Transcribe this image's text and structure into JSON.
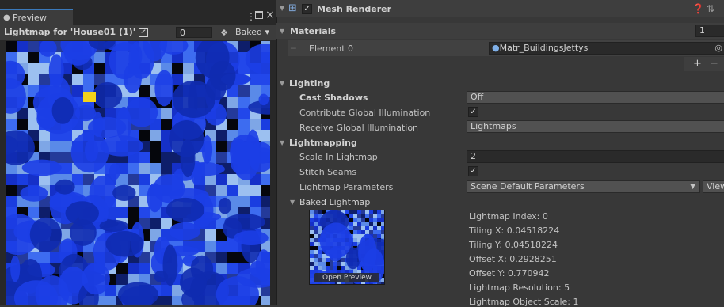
{
  "preview": {
    "tab_label": "Preview",
    "lightmap_title": "Lightmap for 'House01 (1)'",
    "lightmap_index": "0",
    "baked_label": "Baked"
  },
  "inspector": {
    "component_title": "Mesh Renderer",
    "materials": {
      "section": "Materials",
      "count": "1",
      "element_label": "Element 0",
      "element_value": "Matr_BuildingsJettys",
      "add": "+",
      "remove": "−"
    },
    "lighting": {
      "section": "Lighting",
      "cast_shadows_label": "Cast Shadows",
      "cast_shadows_value": "Off",
      "contribute_gi_label": "Contribute Global Illumination",
      "contribute_gi_checked": true,
      "receive_gi_label": "Receive Global Illumination",
      "receive_gi_value": "Lightmaps"
    },
    "lightmapping": {
      "section": "Lightmapping",
      "scale_label": "Scale In Lightmap",
      "scale_value": "2",
      "stitch_label": "Stitch Seams",
      "stitch_checked": true,
      "params_label": "Lightmap Parameters",
      "params_value": "Scene Default Parameters",
      "view_button": "View",
      "baked_lightmap_label": "Baked Lightmap",
      "open_preview": "Open Preview",
      "info": [
        "Lightmap Index: 0",
        "Tiling X: 0.04518224",
        "Tiling Y: 0.04518224",
        "Offset X: 0.2928251",
        "Offset Y: 0.770942",
        "Lightmap Resolution: 5",
        "Lightmap Object Scale: 1"
      ]
    }
  },
  "colors": {
    "accent": "#3a79bb",
    "lightmap_blue": "#1a3de0",
    "highlight_yellow": "#f2d21a"
  },
  "icons": {
    "preview_tab": "bullet-icon",
    "tab_menu": "kebab-menu-icon",
    "maximize": "maximize-icon",
    "close": "close-icon",
    "texture": "texture-icon",
    "layers": "layers-icon",
    "help": "help-icon",
    "settings": "settings-icon",
    "material": "material-sphere-icon",
    "object_picker": "object-picker-icon"
  }
}
